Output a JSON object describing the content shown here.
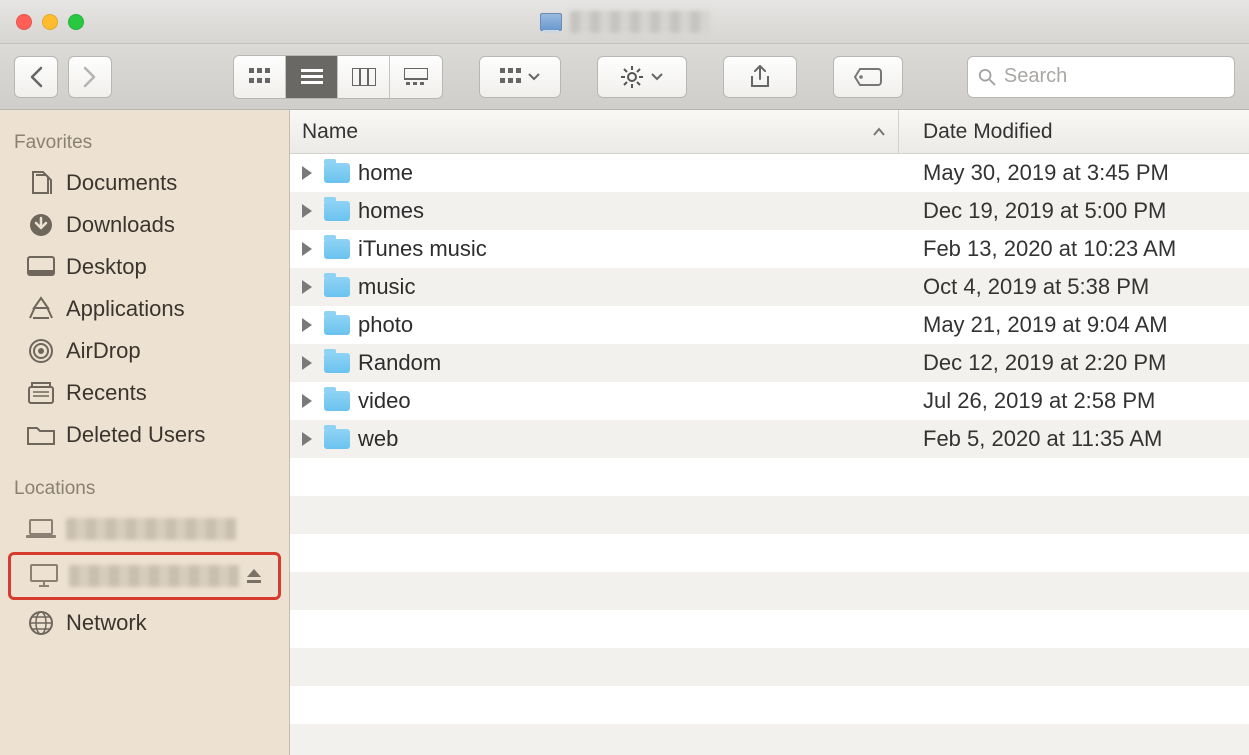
{
  "titlebar": {
    "title": ""
  },
  "toolbar": {
    "search_placeholder": "Search"
  },
  "sidebar": {
    "sections": [
      {
        "label": "Favorites",
        "items": [
          {
            "label": "Documents",
            "icon": "document-icon"
          },
          {
            "label": "Downloads",
            "icon": "download-icon"
          },
          {
            "label": "Desktop",
            "icon": "desktop-icon"
          },
          {
            "label": "Applications",
            "icon": "applications-icon"
          },
          {
            "label": "AirDrop",
            "icon": "airdrop-icon"
          },
          {
            "label": "Recents",
            "icon": "recents-icon"
          },
          {
            "label": "Deleted Users",
            "icon": "folder-icon"
          }
        ]
      },
      {
        "label": "Locations",
        "items": [
          {
            "label": "",
            "icon": "laptop-icon",
            "blurred": true
          },
          {
            "label": "",
            "icon": "display-icon",
            "blurred": true,
            "eject": true,
            "highlight": true
          },
          {
            "label": "Network",
            "icon": "network-icon"
          }
        ]
      }
    ]
  },
  "columns": {
    "name": "Name",
    "date": "Date Modified"
  },
  "files": [
    {
      "name": "home",
      "date": "May 30, 2019 at 3:45 PM"
    },
    {
      "name": "homes",
      "date": "Dec 19, 2019 at 5:00 PM"
    },
    {
      "name": "iTunes music",
      "date": "Feb 13, 2020 at 10:23 AM"
    },
    {
      "name": "music",
      "date": "Oct 4, 2019 at 5:38 PM"
    },
    {
      "name": "photo",
      "date": "May 21, 2019 at 9:04 AM"
    },
    {
      "name": "Random",
      "date": "Dec 12, 2019 at 2:20 PM"
    },
    {
      "name": "video",
      "date": "Jul 26, 2019 at 2:58 PM"
    },
    {
      "name": "web",
      "date": "Feb 5, 2020 at 11:35 AM"
    }
  ]
}
